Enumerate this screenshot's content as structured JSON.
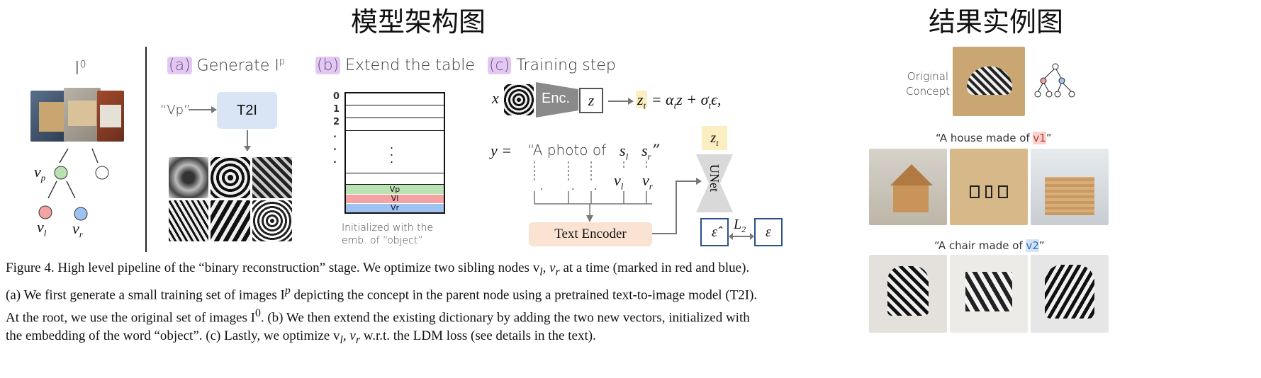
{
  "titles": {
    "architecture": "模型架构图",
    "results": "结果实例图"
  },
  "left": {
    "i0_label": "I",
    "i0_sup": "0",
    "vp": "v",
    "vp_sub": "p",
    "vl": "v",
    "vl_sub": "l",
    "vr": "v",
    "vr_sub": "r"
  },
  "panel_a": {
    "tag": "(a)",
    "title": "Generate I",
    "title_sup": "p",
    "prompt": "“Vp”",
    "t2i": "T2I"
  },
  "panel_b": {
    "tag": "(b)",
    "title": "Extend the table",
    "rows": [
      "0",
      "1",
      "2",
      ".",
      ".",
      "."
    ],
    "new_rows": [
      "Vp",
      "Vl",
      "Vr"
    ],
    "note_line1": "Initialized with the",
    "note_line2": "emb. of “object”"
  },
  "panel_c": {
    "tag": "(c)",
    "title": "Training step",
    "x": "x",
    "enc": "Enc.",
    "z": "z",
    "zt": "z",
    "zt_sub": "t",
    "formula": "= α",
    "y_eq": "y =",
    "prompt_text": "“A photo of",
    "sl": "s",
    "sl_sub": "l",
    "sr": "s",
    "sr_sub": "r",
    "close_q": "”",
    "vl": "v",
    "vl_sub": "l",
    "vr": "v",
    "vr_sub": "r",
    "text_encoder": "Text Encoder",
    "unet": "UNet",
    "eps_hat": "ε̂",
    "l2": "L",
    "l2_sub": "2",
    "eps": "ε"
  },
  "caption": {
    "line1": "Figure 4. High level pipeline of the “binary reconstruction” stage. We optimize two sibling nodes v",
    "line1_end": " at a time (marked in red and blue).",
    "line2": "(a) We first generate a small training set of images I",
    "line2_end": " depicting the concept in the parent node using a pretrained text-to-image model (T2I).",
    "line3": "At the root, we use the original set of images I",
    "line3_end": ". (b) We then extend the existing dictionary by adding the two new vectors, initialized with",
    "line4": "the embedding of the word “object”. (c) Lastly, we optimize v",
    "line4_end": " w.r.t. the LDM loss (see details in the text)."
  },
  "results": {
    "orig_line1": "Original",
    "orig_line2": "Concept",
    "house_prompt": "“A house made of ",
    "house_token": "v1",
    "chair_prompt": "“A chair made of ",
    "chair_token": "v2",
    "q_end": "”"
  }
}
